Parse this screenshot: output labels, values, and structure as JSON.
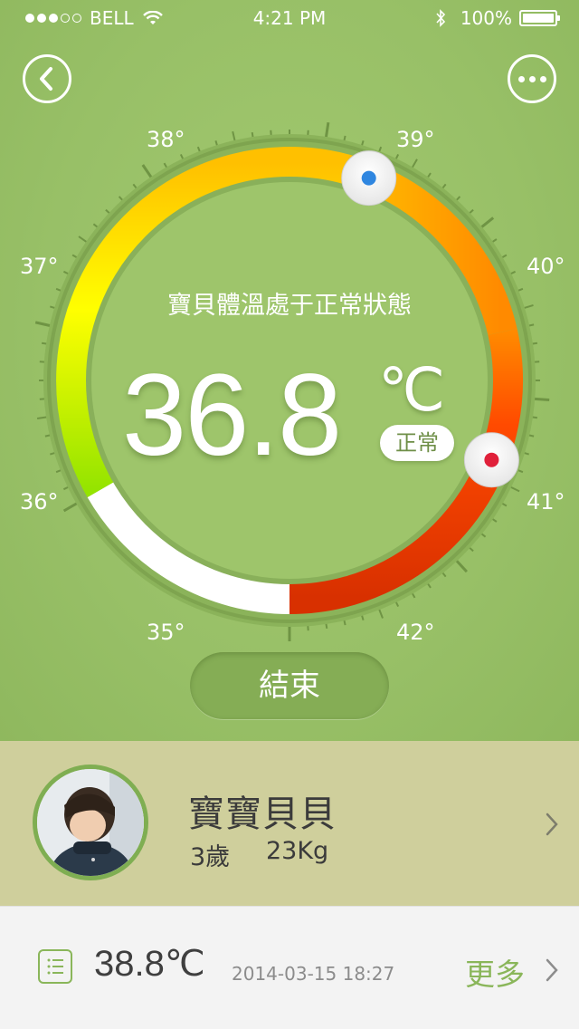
{
  "status_bar": {
    "carrier": "BELL",
    "time": "4:21 PM",
    "battery": "100%",
    "signal_bars": 3,
    "signal_max": 5
  },
  "gauge": {
    "tick_labels": [
      "35°",
      "36°",
      "37°",
      "38°",
      "39°",
      "40°",
      "41°",
      "42°"
    ],
    "status_text": "寶貝體溫處于正常狀態",
    "current_value": "36.8",
    "unit": "℃",
    "badge": "正常",
    "current_reading": 36.8,
    "alarm_marker": 40.4,
    "colors": [
      "#e9f56a",
      "#95e400",
      "#ffff00",
      "#ff8a00",
      "#ff4a00",
      "#d83000"
    ]
  },
  "end_button": {
    "label": "結束"
  },
  "profile": {
    "name": "寶寶貝貝",
    "age": "3歲",
    "weight": "23Kg"
  },
  "record": {
    "temperature": "38.8℃",
    "timestamp": "2014-03-15 18:27",
    "more_label": "更多"
  },
  "icons": {
    "back": "chevron-left-icon",
    "more": "ellipsis-icon",
    "list": "list-icon",
    "chevron": "chevron-right-icon"
  }
}
